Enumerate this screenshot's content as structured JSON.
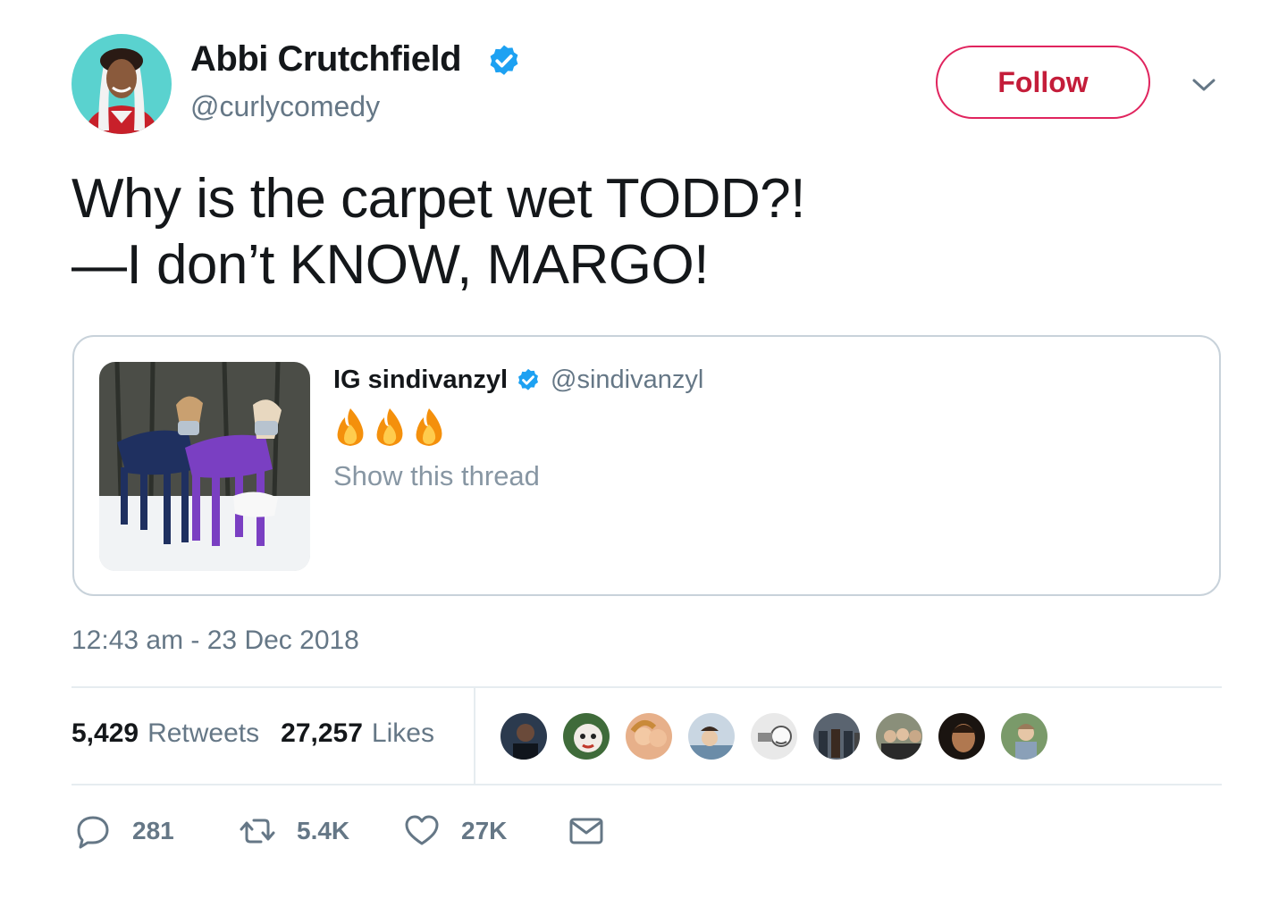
{
  "author": {
    "display_name": "Abbi Crutchfield",
    "handle": "@curlycomedy",
    "verified": true
  },
  "follow_button": {
    "label": "Follow"
  },
  "tweet": {
    "lines": [
      "Why is the carpet wet TODD?!",
      "—I don’t KNOW, MARGO!"
    ],
    "timestamp": "12:43 am - 23 Dec 2018"
  },
  "quoted_tweet": {
    "name": "IG sindivanzyl",
    "handle": "@sindivanzyl",
    "verified": true,
    "emoji": [
      "fire-emoji",
      "fire-emoji",
      "fire-emoji"
    ],
    "thread_link": "Show this thread"
  },
  "stats": {
    "retweets_count": "5,429",
    "retweets_label": "Retweets",
    "likes_count": "27,257",
    "likes_label": "Likes"
  },
  "actions": {
    "reply_count": "281",
    "retweet_count": "5.4K",
    "like_count": "27K"
  },
  "icons": [
    "verified-badge-icon",
    "chevron-down-icon",
    "reply-icon",
    "retweet-icon",
    "heart-icon",
    "mail-icon",
    "fire-emoji"
  ],
  "colors": {
    "follow_red": "#e0245e",
    "verified_blue": "#1da1f2",
    "secondary_text": "#657786",
    "border": "#e6ecf0"
  }
}
